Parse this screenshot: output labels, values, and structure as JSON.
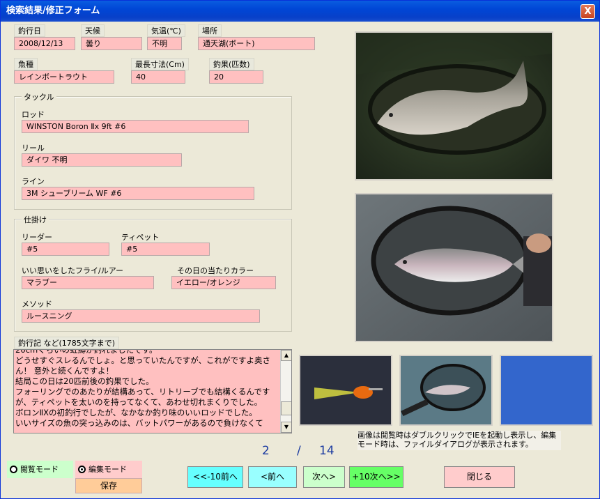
{
  "window": {
    "title": "検索結果/修正フォーム",
    "close_glyph": "X"
  },
  "fields": {
    "date": {
      "label": "釣行日",
      "value": "2008/12/13"
    },
    "weather": {
      "label": "天候",
      "value": "曇り"
    },
    "temp": {
      "label": "気温(℃)",
      "value": "不明"
    },
    "place": {
      "label": "場所",
      "value": "通天湖(ボート)"
    },
    "species": {
      "label": "魚種",
      "value": "レインボートラウト"
    },
    "maxlen": {
      "label": "最長寸法(Cm)",
      "value": "40"
    },
    "catch": {
      "label": "釣果(匹数)",
      "value": "20"
    }
  },
  "tackle": {
    "title": "タックル",
    "rod": {
      "label": "ロッド",
      "value": "WINSTON Boron Ⅱx 9ft #6"
    },
    "reel": {
      "label": "リール",
      "value": "ダイワ 不明"
    },
    "line": {
      "label": "ライン",
      "value": "3M シューブリーム WF #6"
    }
  },
  "rig": {
    "title": "仕掛け",
    "leader": {
      "label": "リーダー",
      "value": "#5"
    },
    "tippet": {
      "label": "ティペット",
      "value": "#5"
    },
    "fly": {
      "label": "いい思いをしたフライ/ルアー",
      "value": "マラブー"
    },
    "color": {
      "label": "その日の当たりカラー",
      "value": "イエロー/オレンジ"
    },
    "method": {
      "label": "メソッド",
      "value": "ルースニング"
    }
  },
  "journal": {
    "label": "釣行記 など(1785文字まで)",
    "text": "20cmぐらいの虹鱒が釣れましたです。\nどうせすぐスレるんでしょ。と思っていたんですが、これがですよ奥さん！ 意外と続くんですよ！\n結局この日は20匹前後の釣果でした。\nフォーリングでのあたりが結構あって、リトリーブでも結構くるんですが、ティペットを太いのを持ってなくて、あわせ切れまくりでした。\nボロンⅡXの初釣行でしたが、なかなか釣り味のいいロッドでした。\nいいサイズの魚の突っ込みのは、バットパワーがあるので負けなくて"
  },
  "image_note": "画像は閲覧時はダブルクリックでIEを起動し表示し、編集モード時は、ファイルダイアログが表示されます。",
  "pager": {
    "current": "2",
    "sep": "/",
    "total": "14"
  },
  "modes": {
    "view": "閲覧モード",
    "edit": "編集モード",
    "selected": "edit"
  },
  "buttons": {
    "save": "保存",
    "prev10": "<<-10前へ",
    "prev": "<前へ",
    "next": "次へ>",
    "next10": "+10次へ>>",
    "close": "閉じる"
  },
  "colors": {
    "field_bg": "#ffc0c0",
    "prev10_bg": "#66ffff",
    "prev_bg": "#99ffff",
    "next_bg": "#ccffcc",
    "next10_bg": "#66ff66",
    "close_bg": "#ffcccc",
    "pager_text": "#1a3aa0",
    "empty_thumb": "#3366cc"
  }
}
